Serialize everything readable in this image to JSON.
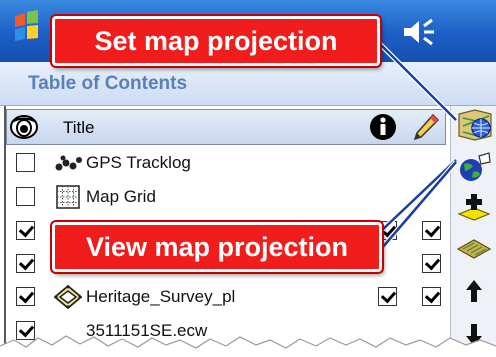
{
  "header": {
    "title": "Table of Contents"
  },
  "columns": {
    "title": "Title"
  },
  "layers": [
    {
      "label": "GPS Tracklog",
      "visible": false,
      "icon": "tracklog-icon"
    },
    {
      "label": "Map Grid",
      "visible": false,
      "icon": "grid-icon"
    },
    {
      "label": "",
      "visible": true,
      "icon": "",
      "col2": true,
      "col3": true
    },
    {
      "label": "",
      "visible": true,
      "icon": "",
      "col2": false,
      "col3": true
    },
    {
      "label": "Heritage_Survey_pl",
      "visible": true,
      "icon": "polygon-layer-icon",
      "col2": true,
      "col3": true
    },
    {
      "label": "3511151SE.ecw",
      "visible": true,
      "icon": "image-layer-icon"
    }
  ],
  "callouts": {
    "set_projection": "Set map projection",
    "view_projection": "View map projection"
  },
  "toolbar": {
    "buttons": [
      "set-projection-icon",
      "view-projection-icon",
      "add-layer-icon",
      "layer-properties-icon",
      "move-up-icon",
      "move-down-icon"
    ]
  },
  "colors": {
    "callout_red": "#f11c1c",
    "titlebar_blue": "#1c5fc6",
    "toc_title": "#5b80b8",
    "leader_line": "#1a3fa0"
  }
}
